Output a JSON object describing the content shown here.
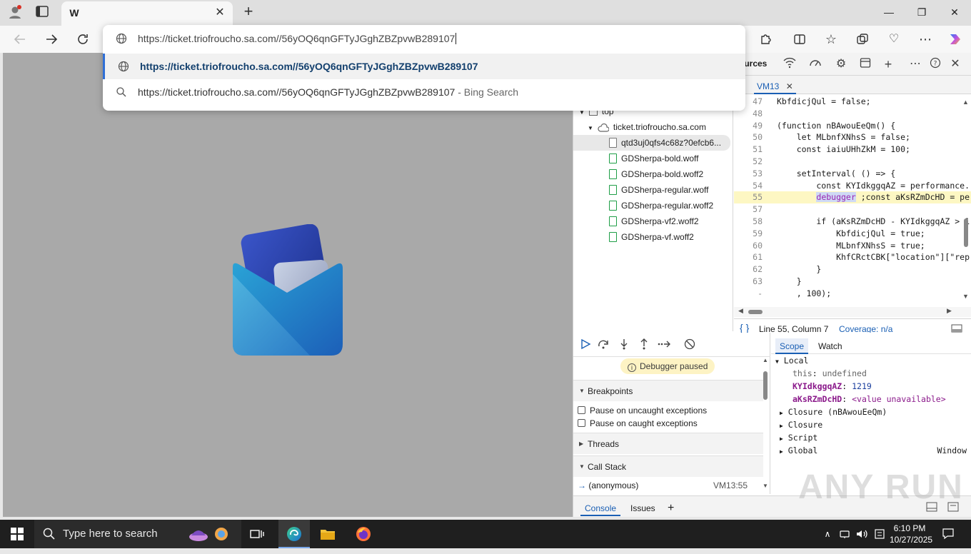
{
  "browser": {
    "tab_favicon": "W",
    "tab_close": "✕",
    "new_tab": "+",
    "window_controls": {
      "minimize": "—",
      "maximize": "❐",
      "close": "✕"
    }
  },
  "omnibox": {
    "input_value": "https://ticket.triofroucho.sa.com//56yOQ6qnGFTyJGghZBZpvwB289107",
    "suggestion_1": "https://ticket.triofroucho.sa.com//56yOQ6qnGFTyJGghZBZpvwB289107",
    "suggestion_2": "https://ticket.triofroucho.sa.com//56yOQ6qnGFTyJGghZBZpvwB289107",
    "suggestion_2_suffix": " - Bing Search"
  },
  "devtools": {
    "panel_tab": "ources",
    "navigator": {
      "top": "top",
      "domain": "ticket.triofroucho.sa.com",
      "files": [
        "qtd3uj0qfs4c68z?0efcb6...",
        "GDSherpa-bold.woff",
        "GDSherpa-bold.woff2",
        "GDSherpa-regular.woff",
        "GDSherpa-regular.woff2",
        "GDSherpa-vf2.woff2",
        "GDSherpa-vf.woff2"
      ]
    },
    "editor": {
      "tab": "VM13",
      "lines": [
        {
          "n": "47",
          "t": "KbfdicjQul = false;"
        },
        {
          "n": "48",
          "t": ""
        },
        {
          "n": "49",
          "t": "(function nBAwouEeQm() {"
        },
        {
          "n": "50",
          "t": "    let MLbnfXNhsS = false;"
        },
        {
          "n": "51",
          "t": "    const iaiuUHhZkM = 100;"
        },
        {
          "n": "52",
          "t": ""
        },
        {
          "n": "53",
          "t": "    setInterval( () => {"
        },
        {
          "n": "54",
          "t": "        const KYIdkggqAZ = performance."
        },
        {
          "n": "55",
          "t": "        debugger ;const aKsRZmDcHD = pe"
        },
        {
          "n": "57",
          "t": ""
        },
        {
          "n": "58",
          "t": "        if (aKsRZmDcHD - KYIdkggqAZ > 1"
        },
        {
          "n": "59",
          "t": "            KbfdicjQul = true;"
        },
        {
          "n": "60",
          "t": "            MLbnfXNhsS = true;"
        },
        {
          "n": "61",
          "t": "            KhfCRctCBK[\"location\"][\"rep"
        },
        {
          "n": "62",
          "t": "        }"
        },
        {
          "n": "63",
          "t": "    }"
        },
        {
          "n": "-",
          "t": "    , 100);"
        }
      ],
      "status_position": "Line 55, Column 7",
      "status_coverage": "Coverage: n/a"
    },
    "debugger": {
      "paused": "Debugger paused",
      "breakpoints_label": "Breakpoints",
      "pause_uncaught": "Pause on uncaught exceptions",
      "pause_caught": "Pause on caught exceptions",
      "threads_label": "Threads",
      "callstack_label": "Call Stack",
      "callstack_frame": "(anonymous)",
      "callstack_loc": "VM13:55"
    },
    "scope": {
      "tab_scope": "Scope",
      "tab_watch": "Watch",
      "local": "Local",
      "this_key": "this",
      "this_val": "undefined",
      "var1_key": "KYIdkggqAZ",
      "var1_val": "1219",
      "var2_key": "aKsRZmDcHD",
      "var2_val": "<value unavailable>",
      "closure1": "Closure (nBAwouEeQm)",
      "closure2": "Closure",
      "script": "Script",
      "global": "Global",
      "global_val": "Window"
    },
    "drawer": {
      "console": "Console",
      "issues": "Issues",
      "add": "+"
    }
  },
  "taskbar": {
    "search_placeholder": "Type here to search",
    "time": "6:10 PM",
    "date": "10/27/2025"
  },
  "watermark": "ANY RUN"
}
